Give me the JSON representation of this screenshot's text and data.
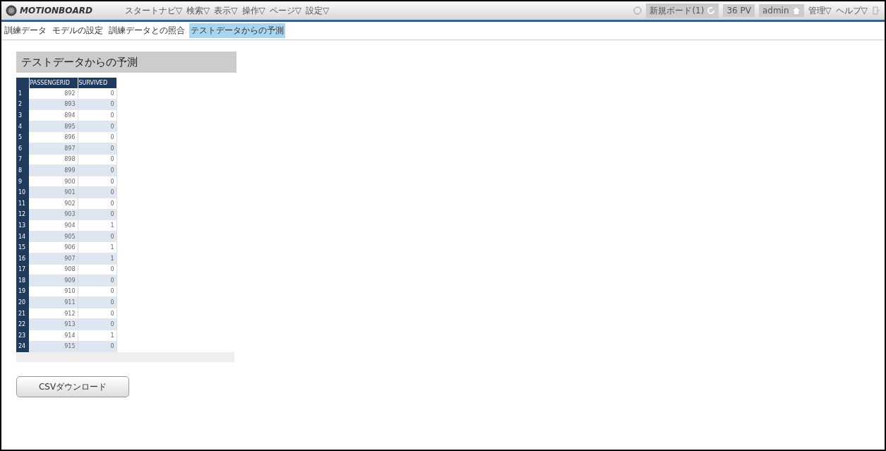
{
  "header": {
    "logo": "MOTIONBOARD",
    "menu": [
      "スタートナビ▽",
      "検索▽",
      "表示▽",
      "操作▽",
      "ページ▽",
      "設定▽"
    ],
    "board": "新規ボード(1)",
    "pv": "36 PV",
    "user": "admin",
    "right_menu": [
      "管理▽",
      "ヘルプ▽"
    ]
  },
  "tabs": [
    {
      "label": "訓練データ",
      "selected": false
    },
    {
      "label": "モデルの設定",
      "selected": false
    },
    {
      "label": "訓練データとの照合",
      "selected": false
    },
    {
      "label": "テストデータからの予測",
      "selected": true
    }
  ],
  "panel": {
    "title": "テストデータからの予測"
  },
  "table": {
    "columns": [
      "",
      "PASSENGERID",
      "SURVIVED"
    ],
    "rows": [
      [
        "1",
        "892",
        "0"
      ],
      [
        "2",
        "893",
        "0"
      ],
      [
        "3",
        "894",
        "0"
      ],
      [
        "4",
        "895",
        "0"
      ],
      [
        "5",
        "896",
        "0"
      ],
      [
        "6",
        "897",
        "0"
      ],
      [
        "7",
        "898",
        "0"
      ],
      [
        "8",
        "899",
        "0"
      ],
      [
        "9",
        "900",
        "0"
      ],
      [
        "10",
        "901",
        "0"
      ],
      [
        "11",
        "902",
        "0"
      ],
      [
        "12",
        "903",
        "0"
      ],
      [
        "13",
        "904",
        "1"
      ],
      [
        "14",
        "905",
        "0"
      ],
      [
        "15",
        "906",
        "1"
      ],
      [
        "16",
        "907",
        "1"
      ],
      [
        "17",
        "908",
        "0"
      ],
      [
        "18",
        "909",
        "0"
      ],
      [
        "19",
        "910",
        "0"
      ],
      [
        "20",
        "911",
        "0"
      ],
      [
        "21",
        "912",
        "0"
      ],
      [
        "22",
        "913",
        "0"
      ],
      [
        "23",
        "914",
        "1"
      ],
      [
        "24",
        "915",
        "0"
      ]
    ]
  },
  "download_button": "CSVダウンロード"
}
